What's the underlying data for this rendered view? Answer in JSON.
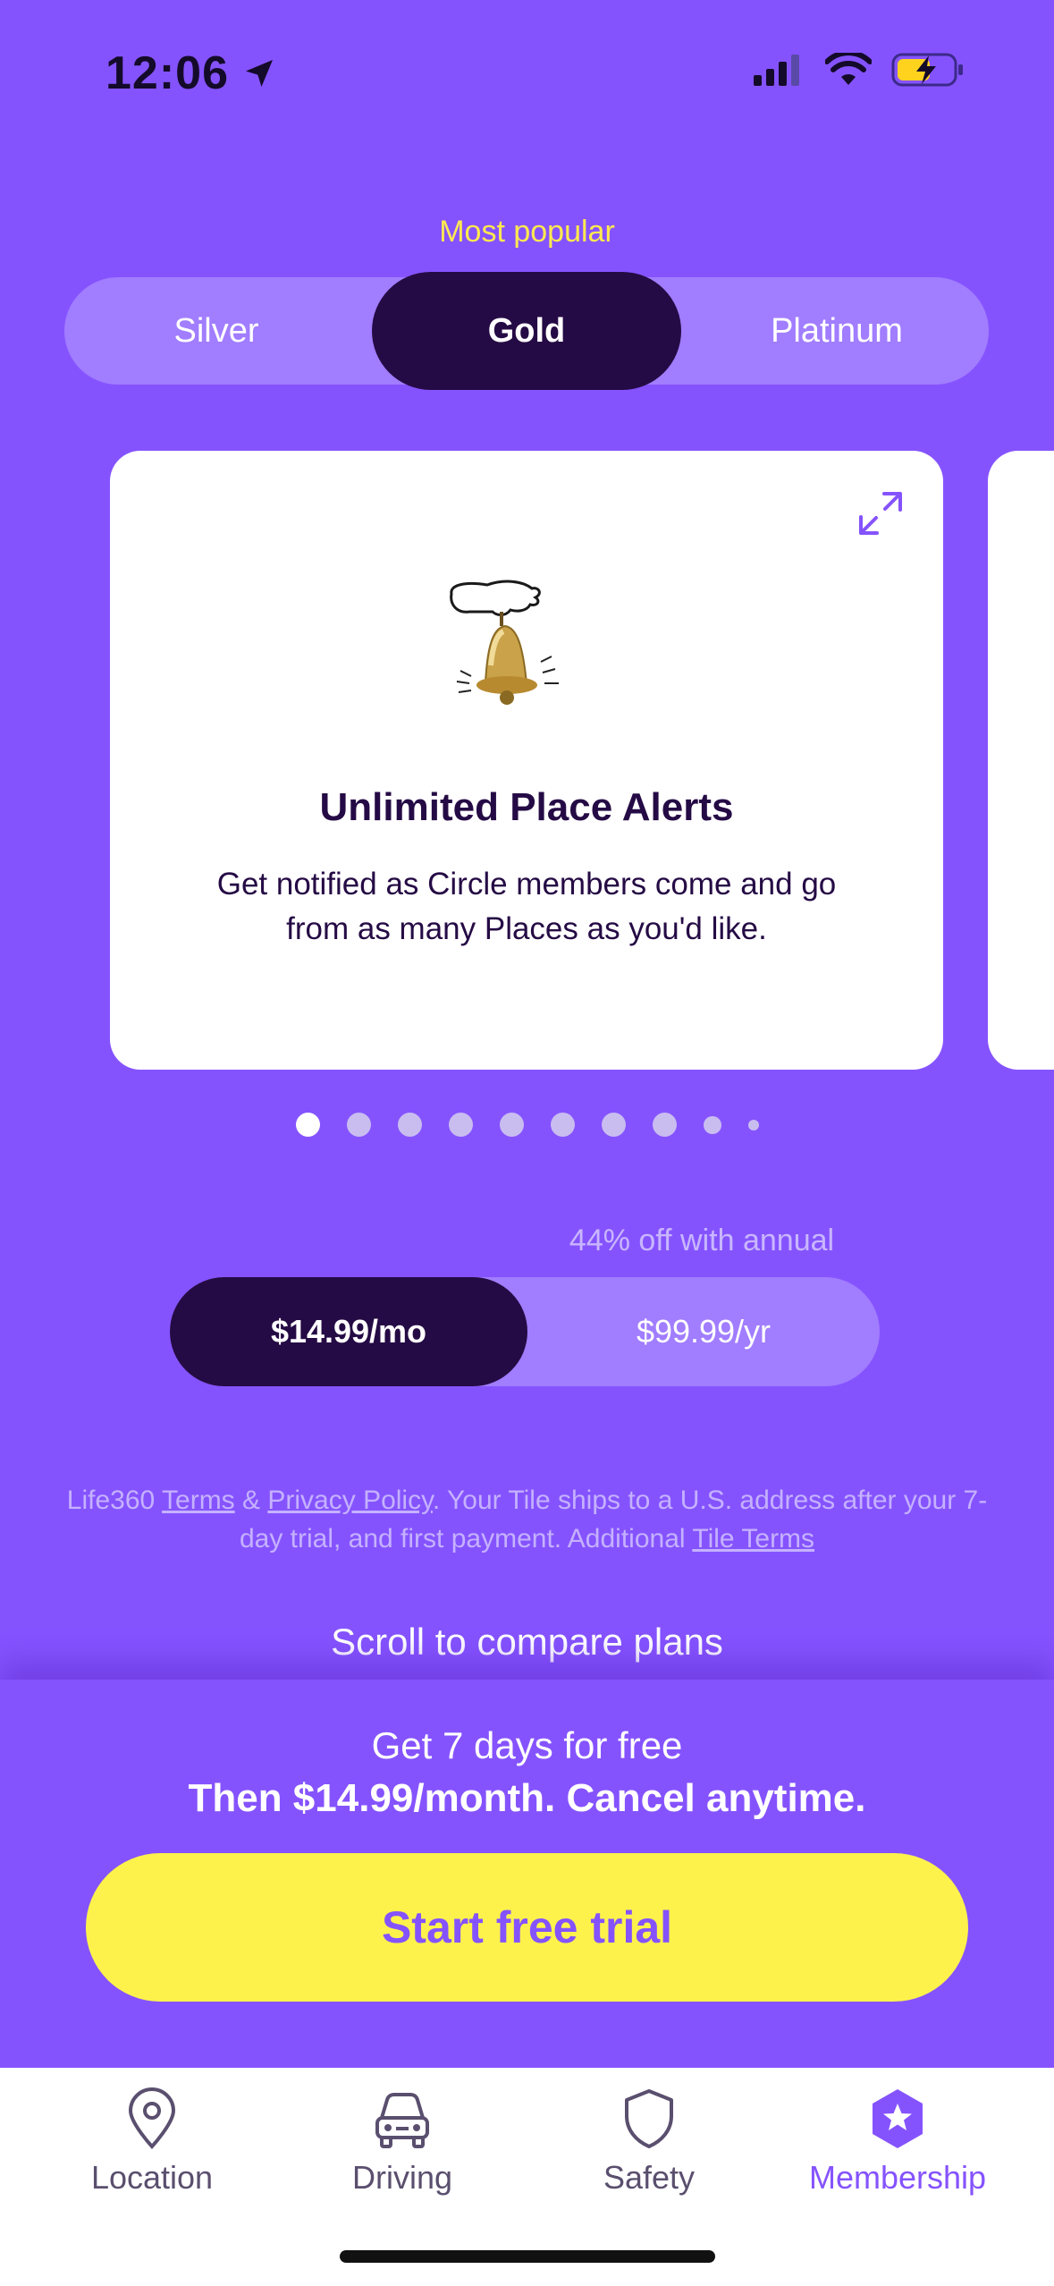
{
  "status": {
    "time": "12:06"
  },
  "plans": {
    "badge": "Most popular",
    "tabs": [
      "Silver",
      "Gold",
      "Platinum"
    ],
    "selected": "Gold"
  },
  "feature_card": {
    "title": "Unlimited Place Alerts",
    "description": "Get notified as Circle members come and go from as many Places as you'd like."
  },
  "carousel": {
    "total_dots": 10,
    "active_index": 0
  },
  "billing": {
    "annual_note": "44% off with annual",
    "monthly": "$14.99/mo",
    "yearly": "$99.99/yr",
    "selected": "monthly"
  },
  "legal": {
    "brand": "Life360",
    "terms": "Terms",
    "amp": "&",
    "privacy": "Privacy Policy",
    "rest": ". Your Tile ships to a U.S. address after your 7-day trial, and first payment. Additional",
    "tile_terms": "Tile Terms"
  },
  "scroll_hint": "Scroll to compare plans",
  "offer": {
    "line1": "Get 7 days for free",
    "line2": "Then $14.99/month. Cancel anytime.",
    "cta": "Start free trial"
  },
  "tabbar": {
    "items": [
      {
        "label": "Location",
        "icon": "location-pin-icon"
      },
      {
        "label": "Driving",
        "icon": "car-icon"
      },
      {
        "label": "Safety",
        "icon": "shield-icon"
      },
      {
        "label": "Membership",
        "icon": "star-badge-icon"
      }
    ],
    "active": "Membership"
  },
  "colors": {
    "background": "#8553FE",
    "dark": "#250B45",
    "accent_yellow": "#FDF24C",
    "badge_yellow": "#FFE94F"
  }
}
